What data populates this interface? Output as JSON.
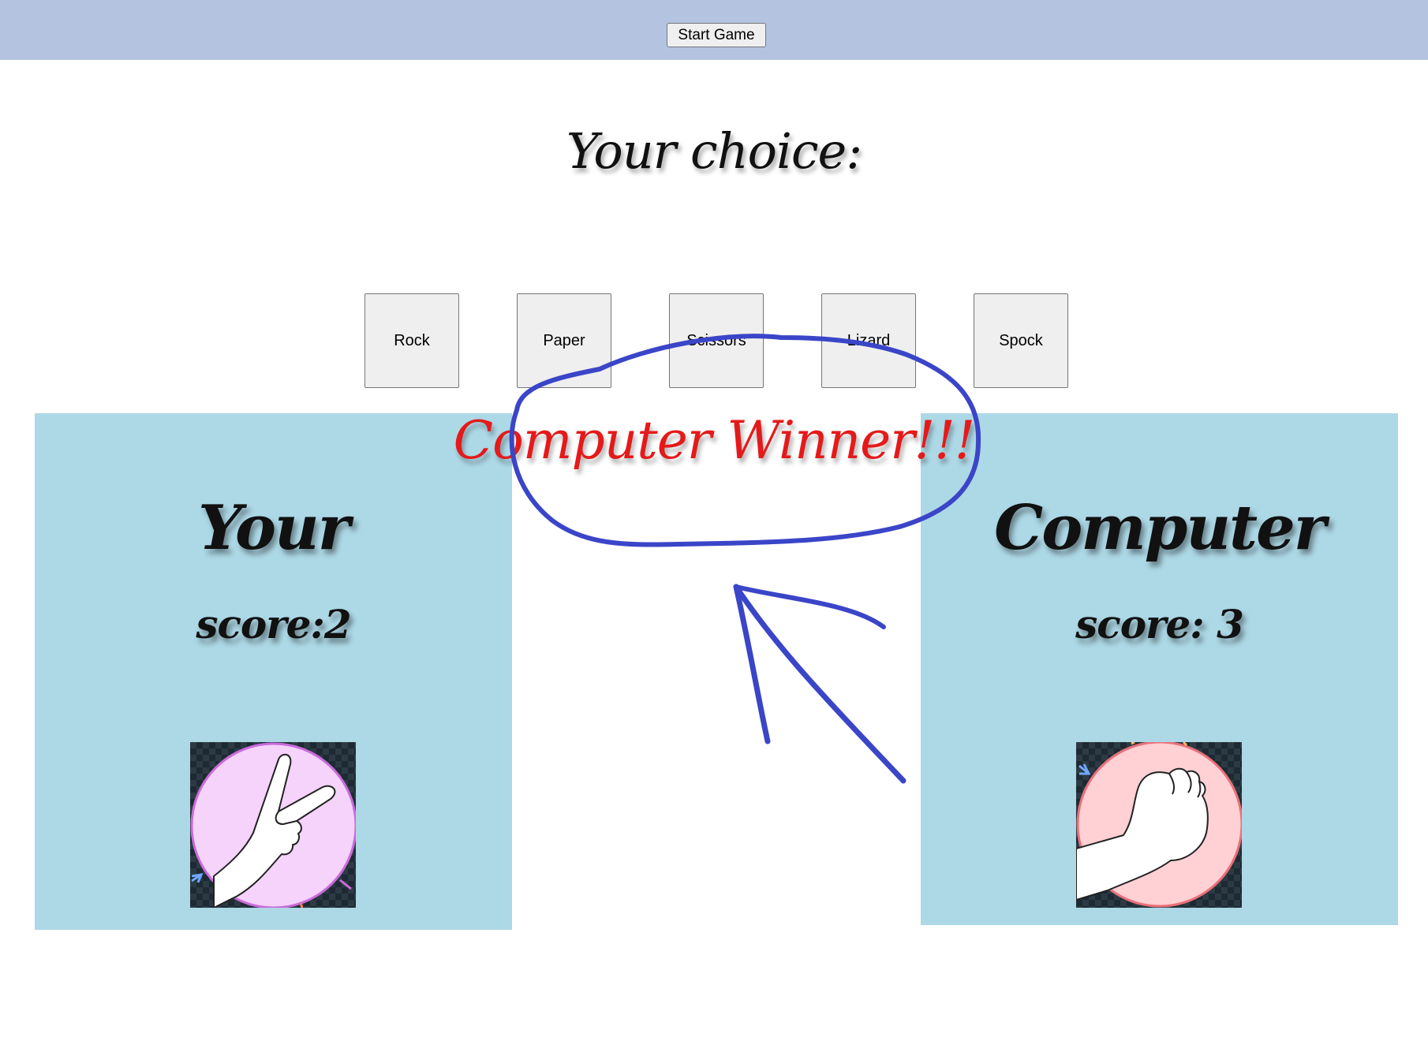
{
  "header": {
    "start_label": "Start Game"
  },
  "choice": {
    "title": "Your choice:",
    "options": [
      "Rock",
      "Paper",
      "Scissors",
      "Lizard",
      "Spock"
    ]
  },
  "result": {
    "text": "Computer Winner!!!",
    "color": "#e41a1a"
  },
  "player": {
    "title": "Your",
    "score_text": "score:2",
    "score": 2,
    "hand": "scissors-hand-icon",
    "circle_color": "#f5d3fb"
  },
  "computer": {
    "title": "Computer",
    "score_text": "score: 3",
    "score": 3,
    "hand": "rock-hand-icon",
    "circle_color": "#ffd0d4"
  },
  "colors": {
    "topbar": "#b4c4e0",
    "panel": "#add8e6",
    "annotation_ink": "#3a45c8"
  }
}
